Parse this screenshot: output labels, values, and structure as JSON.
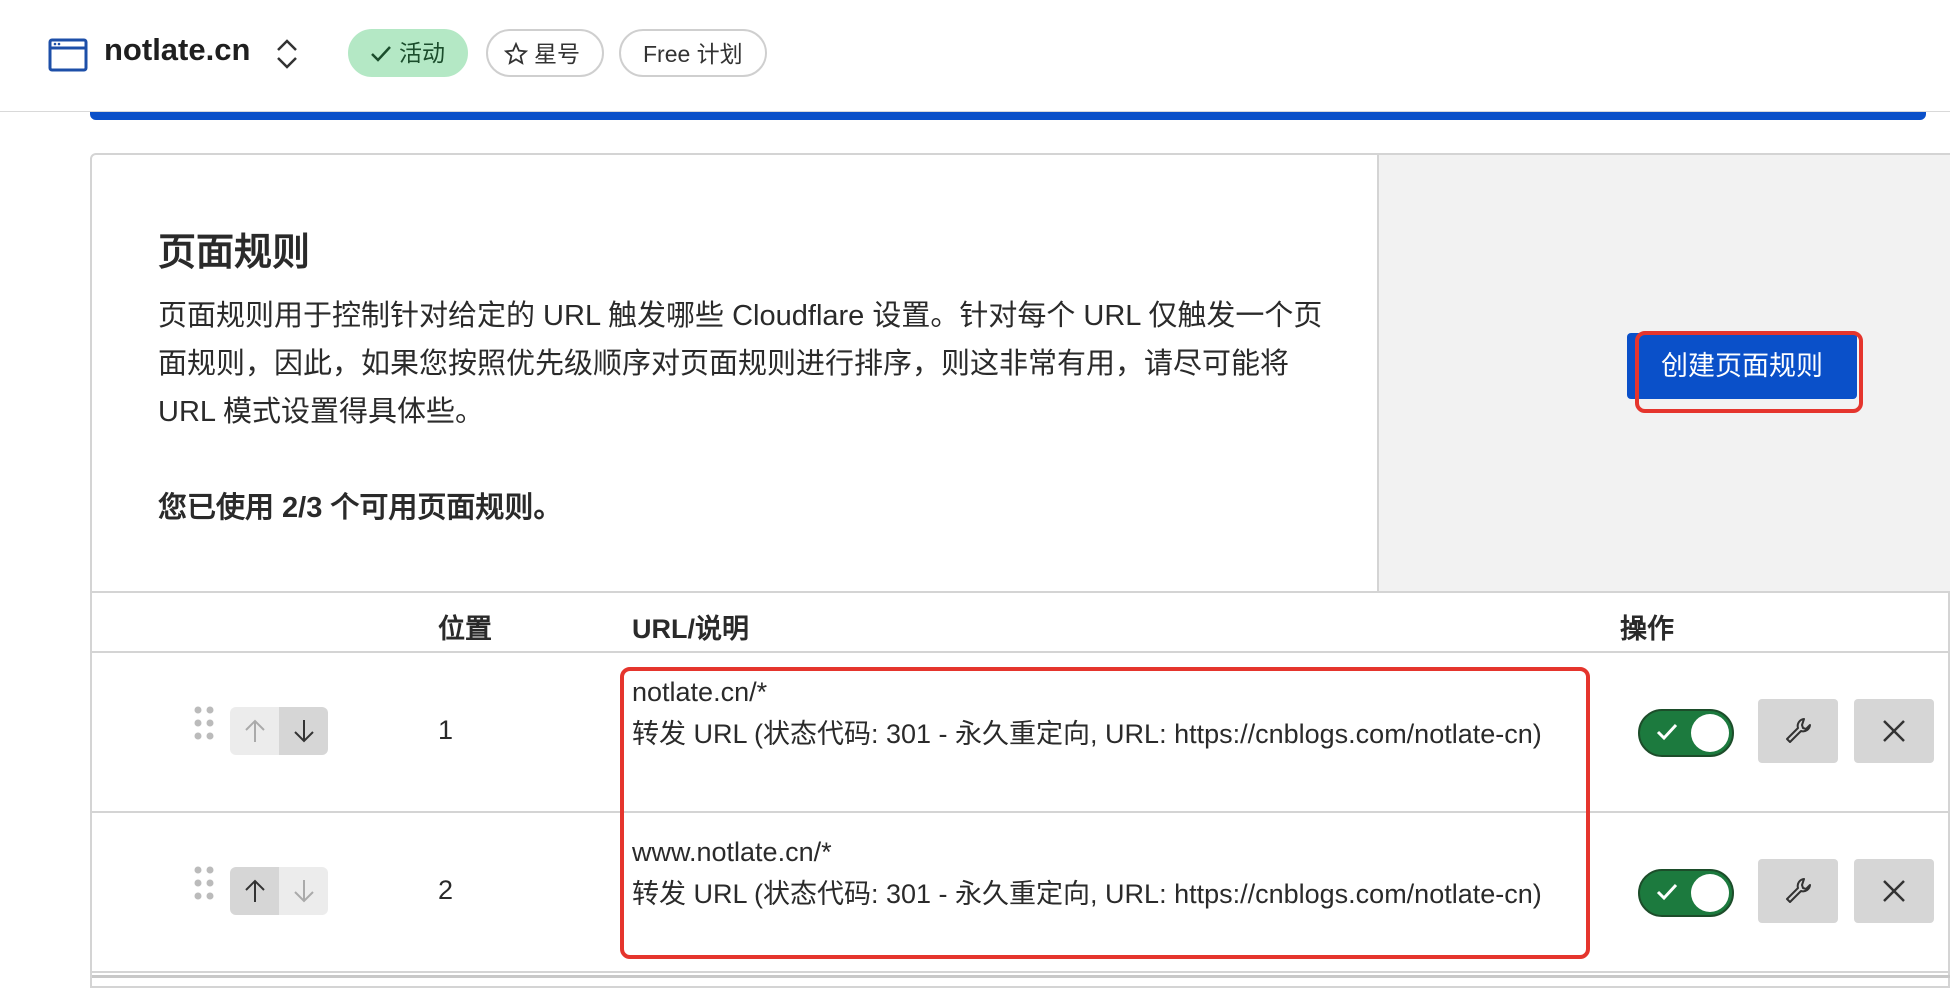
{
  "header": {
    "site_name": "notlate.cn",
    "badges": {
      "active": "活动",
      "star": "星号",
      "plan": "Free 计划"
    }
  },
  "page_rules": {
    "title": "页面规则",
    "description": "页面规则用于控制针对给定的 URL 触发哪些 Cloudflare 设置。针对每个 URL 仅触发一个页面规则，因此，如果您按照优先级顺序对页面规则进行排序，则这非常有用，请尽可能将 URL 模式设置得具体些。",
    "usage": "您已使用 2/3 个可用页面规则。",
    "create_button": "创建页面规则"
  },
  "table": {
    "columns": {
      "position": "位置",
      "url": "URL/说明",
      "actions": "操作"
    },
    "rows": [
      {
        "position": "1",
        "url": "notlate.cn/*",
        "description": "转发 URL (状态代码: 301 - 永久重定向, URL: https://cnblogs.com/notlate-cn)",
        "enabled": true,
        "can_move_up": false,
        "can_move_down": true
      },
      {
        "position": "2",
        "url": "www.notlate.cn/*",
        "description": "转发 URL (状态代码: 301 - 永久重定向, URL: https://cnblogs.com/notlate-cn)",
        "enabled": true,
        "can_move_up": true,
        "can_move_down": false
      }
    ]
  },
  "colors": {
    "primary": "#0a50c9",
    "active_badge": "#b4e8c5",
    "toggle_on": "#1c7a3e",
    "highlight": "#e5352d"
  },
  "icons": {
    "site": "browser-window-icon",
    "switcher": "chevron-up-down-icon",
    "active": "check-icon",
    "star": "star-icon",
    "drag": "drag-handle-icon",
    "up": "arrow-up-icon",
    "down": "arrow-down-icon",
    "edit": "wrench-icon",
    "delete": "close-icon"
  }
}
